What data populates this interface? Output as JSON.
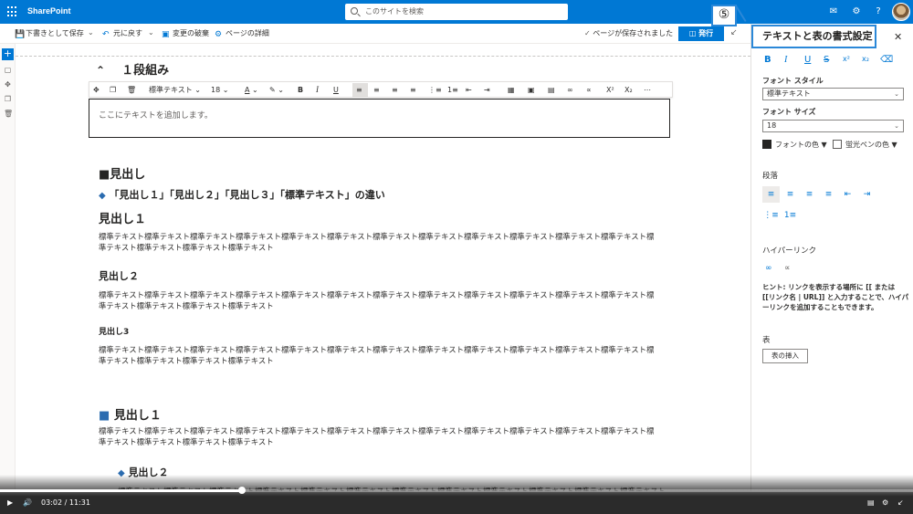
{
  "suite": {
    "brand": "SharePoint",
    "search_placeholder": "このサイトを検索"
  },
  "cmdbar": {
    "save_draft": "下書きとして保存",
    "undo": "元に戻す",
    "discard": "変更の破棄",
    "page_details": "ページの詳細",
    "saved_status": "ページが保存されました",
    "publish": "発行"
  },
  "canvas": {
    "section_title": "１段組み",
    "toolbar": {
      "style": "標準テキスト",
      "size": "18"
    },
    "textbox_placeholder": "ここにテキストを追加します。",
    "heading_square": "■見出し",
    "heading_diamond": "「見出し１」「見出し２」「見出し３」「標準テキスト」の違い",
    "h1": "見出し１",
    "h2": "見出し２",
    "h3": "見出し3",
    "body_text": "標準テキスト標準テキスト標準テキスト標準テキスト標準テキスト標準テキスト標準テキスト標準テキスト標準テキスト標準テキスト標準テキスト標準テキスト標準テキスト標準テキスト標準テキスト標準テキスト",
    "heading_big": "見出し１",
    "heading_sub": "見出し２"
  },
  "panel": {
    "title": "テキストと表の書式設定",
    "font_style_label": "フォント スタイル",
    "font_style_value": "標準テキスト",
    "font_size_label": "フォント サイズ",
    "font_size_value": "18",
    "font_color": "フォントの色",
    "highlight_color": "蛍光ペンの色",
    "paragraph": "段落",
    "hyperlink": "ハイパーリンク",
    "hint": "ヒント: リンクを表示する場所に [[ または [[リンク名 | URL]] と入力することで、ハイパーリンクを追加することもできます。",
    "table": "表",
    "insert_table": "表の挿入",
    "colors": {
      "font": "#252423",
      "highlight": "#ffffff"
    }
  },
  "callout": "⑤",
  "video": {
    "current": "03:02",
    "total": "11:31",
    "separator": "/",
    "progress": 0.265
  },
  "colors": {
    "accent": "#0078d4",
    "callout_border": "#2b88d8"
  }
}
